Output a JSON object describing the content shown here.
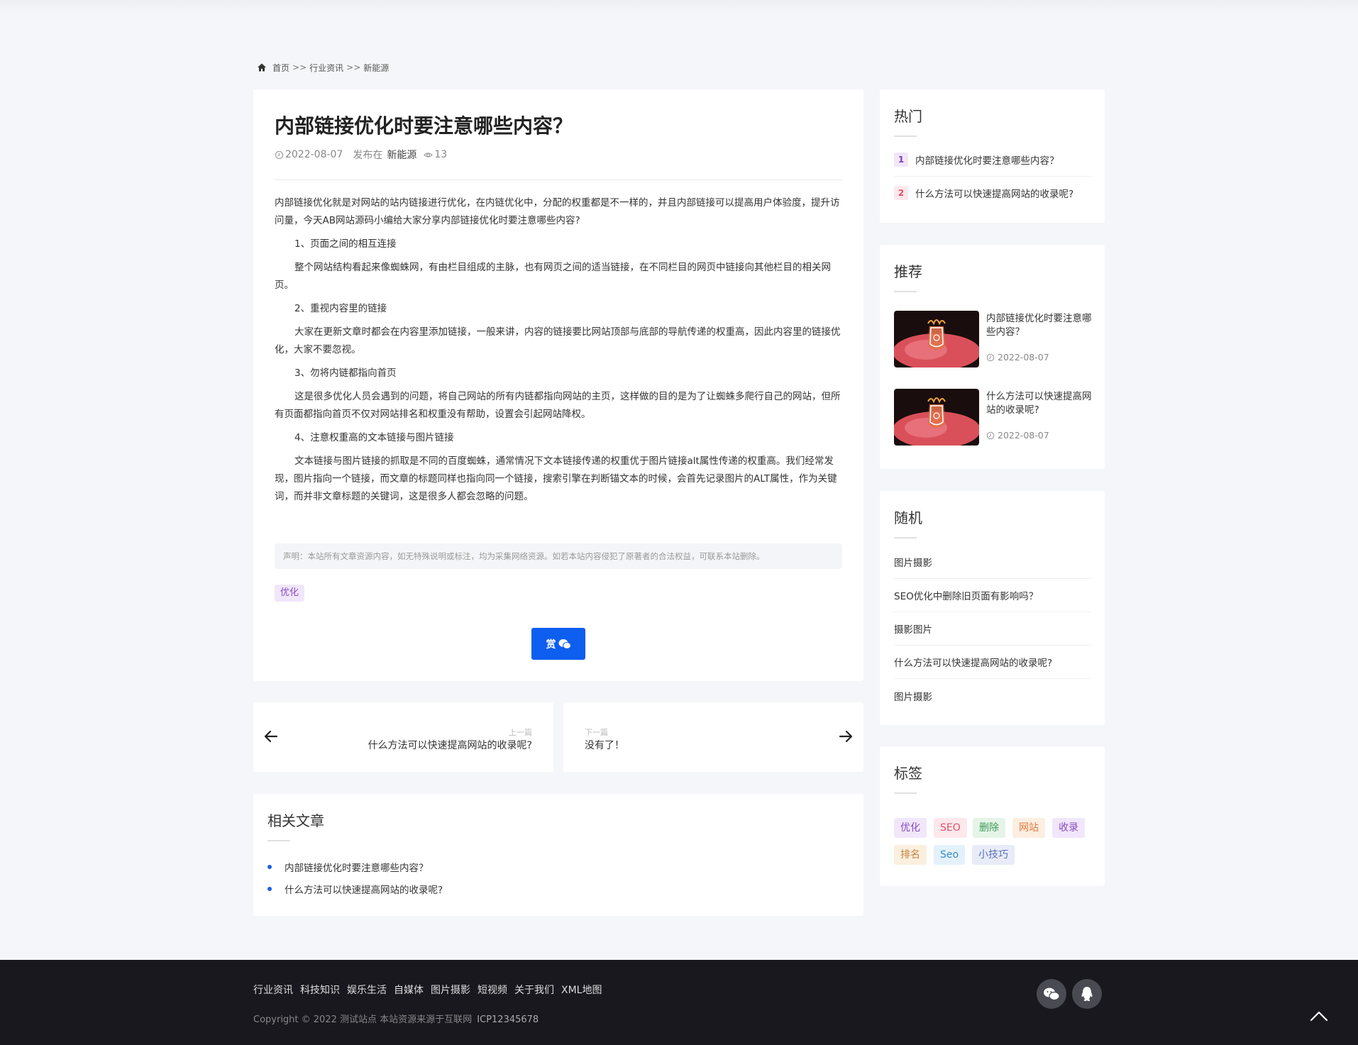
{
  "breadcrumb": {
    "home": "首页",
    "sep": ">>",
    "category": "行业资讯",
    "current": "新能源"
  },
  "article": {
    "title": "内部链接优化时要注意哪些内容？",
    "date": "2022-08-07",
    "published_in": "发布在",
    "category": "新能源",
    "views": "13",
    "paragraphs": [
      "内部链接优化就是对网站的站内链接进行优化，在内链优化中，分配的权重都是不一样的，并且内部链接可以提高用户体验度，提升访问量，今天AB网站源码小编给大家分享内部链接优化时要注意哪些内容?",
      "1、页面之间的相互连接",
      "整个网站结构看起来像蜘蛛网，有由栏目组成的主脉，也有网页之间的适当链接，在不同栏目的网页中链接向其他栏目的相关网页。",
      "2、重视内容里的链接",
      "大家在更新文章时都会在内容里添加链接，一般来讲，内容的链接要比网站顶部与底部的导航传递的权重高，因此内容里的链接优化，大家不要忽视。",
      "3、勿将内链都指向首页",
      "这是很多优化人员会遇到的问题，将自己网站的所有内链都指向网站的主页，这样做的目的是为了让蜘蛛多爬行自己的网站，但所有页面都指向首页不仅对网站排名和权重没有帮助，设置会引起网站降权。",
      "4、注意权重高的文本链接与图片链接",
      "文本链接与图片链接的抓取是不同的百度蜘蛛，通常情况下文本链接传递的权重优于图片链接alt属性传递的权重高。我们经常发现，图片指向一个链接，而文章的标题同样也指向同一个链接，搜索引擎在判断锚文本的时候，会首先记录图片的ALT属性，作为关键词，而并非文章标题的关键词，这是很多人都会忽略的问题。"
    ],
    "notice": "声明：本站所有文章资源内容，如无特殊说明或标注，均为采集网络资源。如若本站内容侵犯了原著者的合法权益，可联系本站删除。",
    "tag": "优化",
    "reward_label": "赏"
  },
  "prev": {
    "small": "上一篇",
    "title": "什么方法可以快速提高网站的收录呢?"
  },
  "next": {
    "small": "下一篇",
    "title": "没有了！"
  },
  "related": {
    "heading": "相关文章",
    "items": [
      "内部链接优化时要注意哪些内容？",
      "什么方法可以快速提高网站的收录呢?"
    ]
  },
  "hot": {
    "heading": "热门",
    "items": [
      {
        "num": "1",
        "title": "内部链接优化时要注意哪些内容？",
        "color": "#7c3fb8",
        "bg": "#f1e6fa"
      },
      {
        "num": "2",
        "title": "什么方法可以快速提高网站的收录呢?",
        "color": "#e0506a",
        "bg": "#fde8ec"
      }
    ]
  },
  "recommend": {
    "heading": "推荐",
    "items": [
      {
        "title": "内部链接优化时要注意哪些内容？",
        "date": "2022-08-07"
      },
      {
        "title": "什么方法可以快速提高网站的收录呢?",
        "date": "2022-08-07"
      }
    ]
  },
  "random": {
    "heading": "随机",
    "items": [
      "图片摄影",
      "SEO优化中删除旧页面有影响吗？",
      "摄影图片",
      "什么方法可以快速提高网站的收录呢?",
      "图片摄影"
    ]
  },
  "tags": {
    "heading": "标签",
    "items": [
      {
        "label": "优化",
        "color": "#8a4cc4",
        "bg": "#f1e6fa"
      },
      {
        "label": "SEO",
        "color": "#e0506a",
        "bg": "#fde8ec"
      },
      {
        "label": "删除",
        "color": "#3f9a56",
        "bg": "#e5f4e8"
      },
      {
        "label": "网站",
        "color": "#e07a3c",
        "bg": "#fdeee2"
      },
      {
        "label": "收录",
        "color": "#8a4cc4",
        "bg": "#f1e6fa"
      },
      {
        "label": "排名",
        "color": "#c7833a",
        "bg": "#fbefe0"
      },
      {
        "label": "Seo",
        "color": "#3a8ec4",
        "bg": "#e3f1fa"
      },
      {
        "label": "小技巧",
        "color": "#5a6fb8",
        "bg": "#e8ecf8"
      }
    ]
  },
  "footer": {
    "links": [
      "行业资讯",
      "科技知识",
      "娱乐生活",
      "自媒体",
      "图片摄影",
      "短视频",
      "关于我们",
      "XML地图"
    ],
    "copyright": "Copyright © 2022 测试站点 本站资源来源于互联网",
    "icp": "ICP12345678"
  },
  "colors": {
    "accent": "#0e5ef0",
    "footer_bg": "#18181e",
    "page_bg": "#f5f6f9"
  }
}
